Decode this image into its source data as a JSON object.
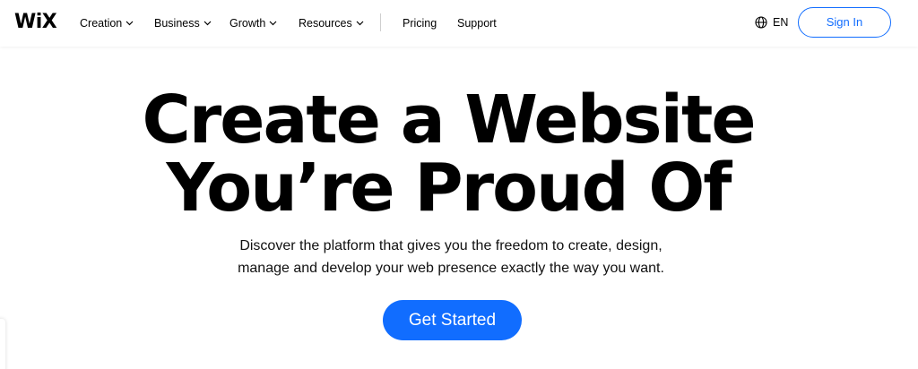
{
  "brand": {
    "logo_text": "WiX",
    "accent": "#116dff"
  },
  "nav": {
    "items": [
      {
        "label": "Creation",
        "has_dropdown": true
      },
      {
        "label": "Business",
        "has_dropdown": true
      },
      {
        "label": "Growth",
        "has_dropdown": true
      },
      {
        "label": "Resources",
        "has_dropdown": true
      },
      {
        "label": "Pricing",
        "has_dropdown": false
      },
      {
        "label": "Support",
        "has_dropdown": false
      }
    ],
    "language": {
      "label": "EN",
      "icon": "globe-icon"
    },
    "sign_in_label": "Sign In"
  },
  "hero": {
    "title_line1": "Create a Website",
    "title_line2": "You’re Proud Of",
    "subtitle_line1": "Discover the platform that gives you the freedom to create, design,",
    "subtitle_line2": "manage and develop your web presence exactly the way you want.",
    "cta_label": "Get Started"
  }
}
